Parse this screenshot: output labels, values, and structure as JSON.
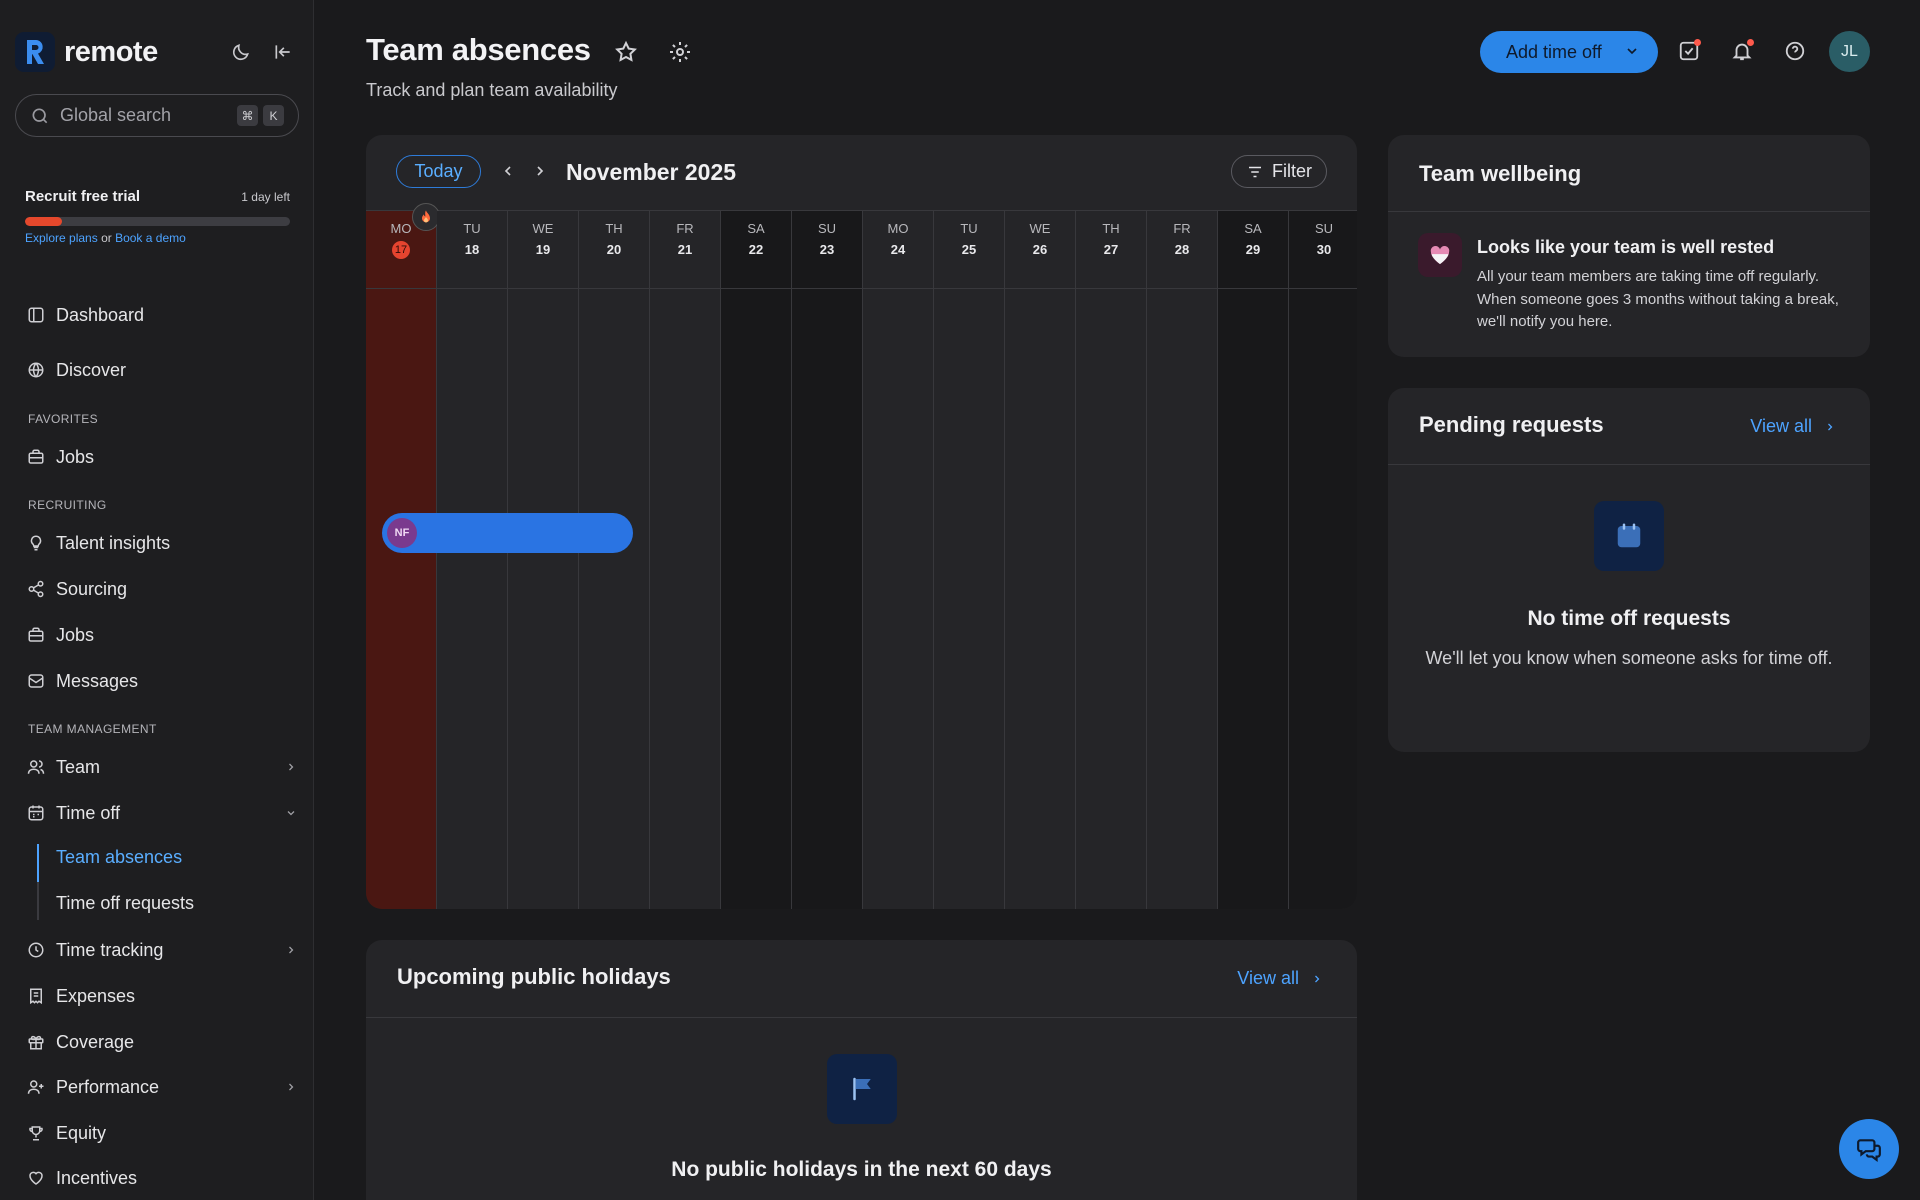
{
  "app": {
    "logo_text": "remote",
    "logo_letter": "R"
  },
  "search": {
    "placeholder": "Global search",
    "kbd_cmd": "⌘",
    "kbd_key": "K"
  },
  "trial": {
    "title": "Recruit free trial",
    "days_left": "1 day left",
    "progress_percent": 14,
    "link_plans": "Explore plans",
    "link_or": "or",
    "link_demo": "Book a demo"
  },
  "nav": {
    "dashboard": "Dashboard",
    "discover": "Discover",
    "section_favorites": "FAVORITES",
    "fav_jobs": "Jobs",
    "section_recruiting": "RECRUITING",
    "talent_insights": "Talent insights",
    "sourcing": "Sourcing",
    "jobs": "Jobs",
    "messages": "Messages",
    "section_team": "TEAM MANAGEMENT",
    "team": "Team",
    "time_off": "Time off",
    "team_absences": "Team absences",
    "time_off_requests": "Time off requests",
    "time_tracking": "Time tracking",
    "expenses": "Expenses",
    "coverage": "Coverage",
    "performance": "Performance",
    "equity": "Equity",
    "incentives": "Incentives"
  },
  "header": {
    "title": "Team absences",
    "subtitle": "Track and plan team availability",
    "add_button": "Add time off",
    "user_initials": "JL"
  },
  "calendar": {
    "today_label": "Today",
    "month": "November 2025",
    "filter_label": "Filter",
    "days": [
      {
        "dow": "MO",
        "num": "17",
        "weekend": false,
        "today": true
      },
      {
        "dow": "TU",
        "num": "18",
        "weekend": false,
        "today": false
      },
      {
        "dow": "WE",
        "num": "19",
        "weekend": false,
        "today": false
      },
      {
        "dow": "TH",
        "num": "20",
        "weekend": false,
        "today": false
      },
      {
        "dow": "FR",
        "num": "21",
        "weekend": false,
        "today": false
      },
      {
        "dow": "SA",
        "num": "22",
        "weekend": true,
        "today": false
      },
      {
        "dow": "SU",
        "num": "23",
        "weekend": true,
        "today": false
      },
      {
        "dow": "MO",
        "num": "24",
        "weekend": false,
        "today": false
      },
      {
        "dow": "TU",
        "num": "25",
        "weekend": false,
        "today": false
      },
      {
        "dow": "WE",
        "num": "26",
        "weekend": false,
        "today": false
      },
      {
        "dow": "TH",
        "num": "27",
        "weekend": false,
        "today": false
      },
      {
        "dow": "FR",
        "num": "28",
        "weekend": false,
        "today": false
      },
      {
        "dow": "SA",
        "num": "29",
        "weekend": true,
        "today": false
      },
      {
        "dow": "SU",
        "num": "30",
        "weekend": true,
        "today": false
      }
    ],
    "absence": {
      "initials": "NF"
    }
  },
  "wellbeing": {
    "title": "Team wellbeing",
    "headline": "Looks like your team is well rested",
    "text": "All your team members are taking time off regularly. When someone goes 3 months without taking a break, we'll notify you here."
  },
  "pending": {
    "title": "Pending requests",
    "view_all": "View all",
    "empty_title": "No time off requests",
    "empty_text": "We'll let you know when someone asks for time off."
  },
  "holidays": {
    "title": "Upcoming public holidays",
    "view_all": "View all",
    "empty_title": "No public holidays in the next 60 days"
  },
  "colors": {
    "accent": "#2b86e8",
    "link": "#4da3ff",
    "today": "#e5442f"
  }
}
